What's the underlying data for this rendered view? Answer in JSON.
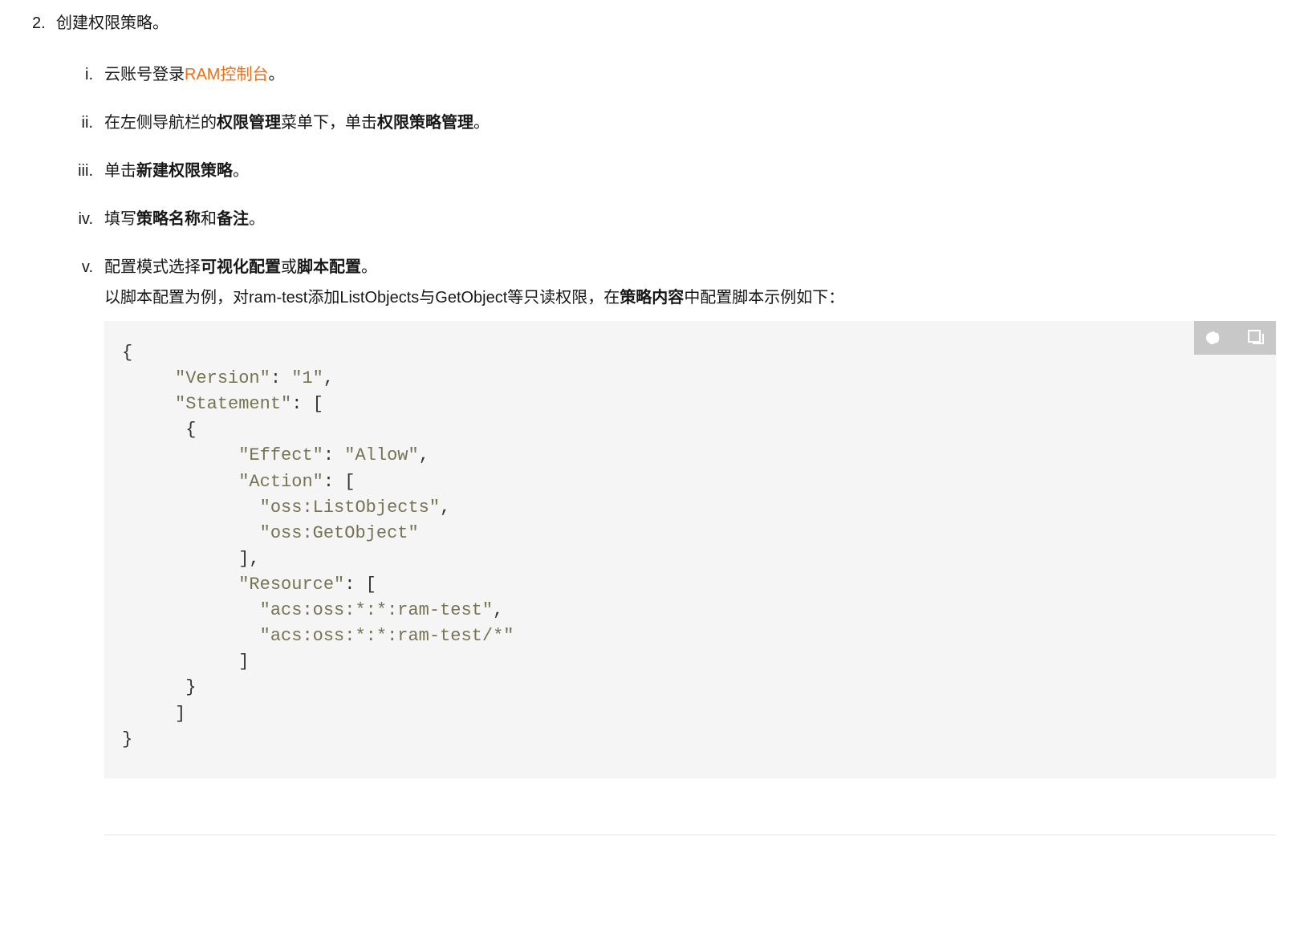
{
  "step": {
    "marker": "2.",
    "title": "创建权限策略。"
  },
  "substeps": [
    {
      "marker": "i.",
      "prefix": "云账号登录",
      "link": "RAM控制台",
      "suffix": "。"
    },
    {
      "marker": "ii.",
      "t1": "在左侧导航栏的",
      "b1": "权限管理",
      "t2": "菜单下，单击",
      "b2": "权限策略管理",
      "t3": "。"
    },
    {
      "marker": "iii.",
      "t1": "单击",
      "b1": "新建权限策略",
      "t2": "。"
    },
    {
      "marker": "iv.",
      "t1": "填写",
      "b1": "策略名称",
      "t2": "和",
      "b2": "备注",
      "t3": "。"
    },
    {
      "marker": "v.",
      "t1": "配置模式选择",
      "b1": "可视化配置",
      "t2": "或",
      "b2": "脚本配置",
      "t3": "。",
      "desc_prefix": "以脚本配置为例，对ram-test添加ListObjects与GetObject等只读权限，在",
      "desc_bold": "策略内容",
      "desc_suffix": "中配置脚本示例如下："
    }
  ],
  "code": {
    "version_key": "\"Version\"",
    "version_val": "\"1\"",
    "statement_key": "\"Statement\"",
    "effect_key": "\"Effect\"",
    "effect_val": "\"Allow\"",
    "action_key": "\"Action\"",
    "action_v1": "\"oss:ListObjects\"",
    "action_v2": "\"oss:GetObject\"",
    "resource_key": "\"Resource\"",
    "resource_v1": "\"acs:oss:*:*:ram-test\"",
    "resource_v2": "\"acs:oss:*:*:ram-test/*\""
  }
}
